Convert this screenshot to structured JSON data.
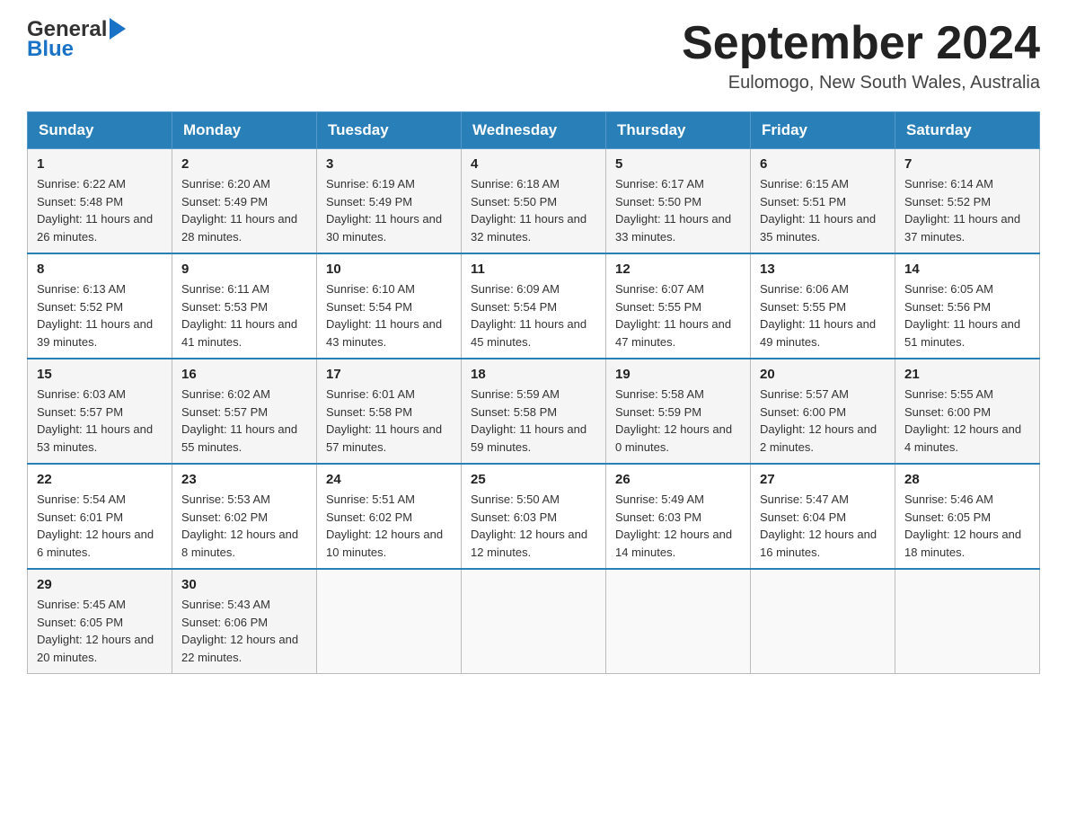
{
  "logo": {
    "text_general": "General",
    "text_blue": "Blue",
    "aria": "GeneralBlue logo"
  },
  "header": {
    "title": "September 2024",
    "subtitle": "Eulomogo, New South Wales, Australia"
  },
  "days_of_week": [
    "Sunday",
    "Monday",
    "Tuesday",
    "Wednesday",
    "Thursday",
    "Friday",
    "Saturday"
  ],
  "weeks": [
    [
      {
        "day": "1",
        "sunrise": "Sunrise: 6:22 AM",
        "sunset": "Sunset: 5:48 PM",
        "daylight": "Daylight: 11 hours and 26 minutes."
      },
      {
        "day": "2",
        "sunrise": "Sunrise: 6:20 AM",
        "sunset": "Sunset: 5:49 PM",
        "daylight": "Daylight: 11 hours and 28 minutes."
      },
      {
        "day": "3",
        "sunrise": "Sunrise: 6:19 AM",
        "sunset": "Sunset: 5:49 PM",
        "daylight": "Daylight: 11 hours and 30 minutes."
      },
      {
        "day": "4",
        "sunrise": "Sunrise: 6:18 AM",
        "sunset": "Sunset: 5:50 PM",
        "daylight": "Daylight: 11 hours and 32 minutes."
      },
      {
        "day": "5",
        "sunrise": "Sunrise: 6:17 AM",
        "sunset": "Sunset: 5:50 PM",
        "daylight": "Daylight: 11 hours and 33 minutes."
      },
      {
        "day": "6",
        "sunrise": "Sunrise: 6:15 AM",
        "sunset": "Sunset: 5:51 PM",
        "daylight": "Daylight: 11 hours and 35 minutes."
      },
      {
        "day": "7",
        "sunrise": "Sunrise: 6:14 AM",
        "sunset": "Sunset: 5:52 PM",
        "daylight": "Daylight: 11 hours and 37 minutes."
      }
    ],
    [
      {
        "day": "8",
        "sunrise": "Sunrise: 6:13 AM",
        "sunset": "Sunset: 5:52 PM",
        "daylight": "Daylight: 11 hours and 39 minutes."
      },
      {
        "day": "9",
        "sunrise": "Sunrise: 6:11 AM",
        "sunset": "Sunset: 5:53 PM",
        "daylight": "Daylight: 11 hours and 41 minutes."
      },
      {
        "day": "10",
        "sunrise": "Sunrise: 6:10 AM",
        "sunset": "Sunset: 5:54 PM",
        "daylight": "Daylight: 11 hours and 43 minutes."
      },
      {
        "day": "11",
        "sunrise": "Sunrise: 6:09 AM",
        "sunset": "Sunset: 5:54 PM",
        "daylight": "Daylight: 11 hours and 45 minutes."
      },
      {
        "day": "12",
        "sunrise": "Sunrise: 6:07 AM",
        "sunset": "Sunset: 5:55 PM",
        "daylight": "Daylight: 11 hours and 47 minutes."
      },
      {
        "day": "13",
        "sunrise": "Sunrise: 6:06 AM",
        "sunset": "Sunset: 5:55 PM",
        "daylight": "Daylight: 11 hours and 49 minutes."
      },
      {
        "day": "14",
        "sunrise": "Sunrise: 6:05 AM",
        "sunset": "Sunset: 5:56 PM",
        "daylight": "Daylight: 11 hours and 51 minutes."
      }
    ],
    [
      {
        "day": "15",
        "sunrise": "Sunrise: 6:03 AM",
        "sunset": "Sunset: 5:57 PM",
        "daylight": "Daylight: 11 hours and 53 minutes."
      },
      {
        "day": "16",
        "sunrise": "Sunrise: 6:02 AM",
        "sunset": "Sunset: 5:57 PM",
        "daylight": "Daylight: 11 hours and 55 minutes."
      },
      {
        "day": "17",
        "sunrise": "Sunrise: 6:01 AM",
        "sunset": "Sunset: 5:58 PM",
        "daylight": "Daylight: 11 hours and 57 minutes."
      },
      {
        "day": "18",
        "sunrise": "Sunrise: 5:59 AM",
        "sunset": "Sunset: 5:58 PM",
        "daylight": "Daylight: 11 hours and 59 minutes."
      },
      {
        "day": "19",
        "sunrise": "Sunrise: 5:58 AM",
        "sunset": "Sunset: 5:59 PM",
        "daylight": "Daylight: 12 hours and 0 minutes."
      },
      {
        "day": "20",
        "sunrise": "Sunrise: 5:57 AM",
        "sunset": "Sunset: 6:00 PM",
        "daylight": "Daylight: 12 hours and 2 minutes."
      },
      {
        "day": "21",
        "sunrise": "Sunrise: 5:55 AM",
        "sunset": "Sunset: 6:00 PM",
        "daylight": "Daylight: 12 hours and 4 minutes."
      }
    ],
    [
      {
        "day": "22",
        "sunrise": "Sunrise: 5:54 AM",
        "sunset": "Sunset: 6:01 PM",
        "daylight": "Daylight: 12 hours and 6 minutes."
      },
      {
        "day": "23",
        "sunrise": "Sunrise: 5:53 AM",
        "sunset": "Sunset: 6:02 PM",
        "daylight": "Daylight: 12 hours and 8 minutes."
      },
      {
        "day": "24",
        "sunrise": "Sunrise: 5:51 AM",
        "sunset": "Sunset: 6:02 PM",
        "daylight": "Daylight: 12 hours and 10 minutes."
      },
      {
        "day": "25",
        "sunrise": "Sunrise: 5:50 AM",
        "sunset": "Sunset: 6:03 PM",
        "daylight": "Daylight: 12 hours and 12 minutes."
      },
      {
        "day": "26",
        "sunrise": "Sunrise: 5:49 AM",
        "sunset": "Sunset: 6:03 PM",
        "daylight": "Daylight: 12 hours and 14 minutes."
      },
      {
        "day": "27",
        "sunrise": "Sunrise: 5:47 AM",
        "sunset": "Sunset: 6:04 PM",
        "daylight": "Daylight: 12 hours and 16 minutes."
      },
      {
        "day": "28",
        "sunrise": "Sunrise: 5:46 AM",
        "sunset": "Sunset: 6:05 PM",
        "daylight": "Daylight: 12 hours and 18 minutes."
      }
    ],
    [
      {
        "day": "29",
        "sunrise": "Sunrise: 5:45 AM",
        "sunset": "Sunset: 6:05 PM",
        "daylight": "Daylight: 12 hours and 20 minutes."
      },
      {
        "day": "30",
        "sunrise": "Sunrise: 5:43 AM",
        "sunset": "Sunset: 6:06 PM",
        "daylight": "Daylight: 12 hours and 22 minutes."
      },
      null,
      null,
      null,
      null,
      null
    ]
  ]
}
